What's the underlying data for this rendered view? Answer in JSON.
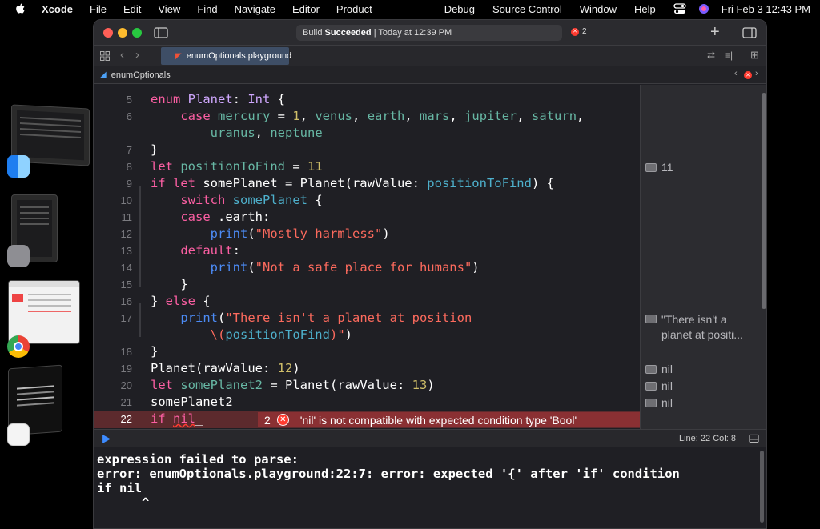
{
  "menubar": {
    "app": "Xcode",
    "items": [
      "File",
      "Edit",
      "View",
      "Find",
      "Navigate",
      "Editor",
      "Product",
      "Debug",
      "Source Control",
      "Window",
      "Help"
    ],
    "datetime": "Fri Feb 3  12:43 PM"
  },
  "window": {
    "status_label": "Build",
    "status_state": "Succeeded",
    "status_time": "| Today at 12:39 PM",
    "error_count": "2",
    "tab_label": "enumOptionals.playground",
    "breadcrumb": "enumOptionals"
  },
  "editor": {
    "line_numbers": [
      "5",
      "6",
      "",
      "7",
      "8",
      "9",
      "10",
      "11",
      "12",
      "13",
      "14",
      "15",
      "16",
      "17",
      "",
      "18",
      "19",
      "20",
      "21",
      "22"
    ],
    "error": {
      "count": "2",
      "message": "'nil' is not compatible with expected condition type 'Bool'"
    }
  },
  "results": {
    "r8": "11",
    "r17a": "\"There isn't a",
    "r17b": "planet at positi...",
    "r19": "nil",
    "r20": "nil",
    "r21": "nil"
  },
  "debugbar": {
    "position": "Line: 22  Col: 8"
  },
  "console": {
    "text": "expression failed to parse:\nerror: enumOptionals.playground:22:7: error: expected '{' after 'if' condition\nif nil\n      ^"
  },
  "colors": {
    "keyword": "#fc5fa3",
    "type": "#d0a8ff",
    "identifier": "#67b7a4",
    "number": "#d0bf69",
    "string": "#fc6a5d",
    "error_bg": "#8a3033"
  }
}
